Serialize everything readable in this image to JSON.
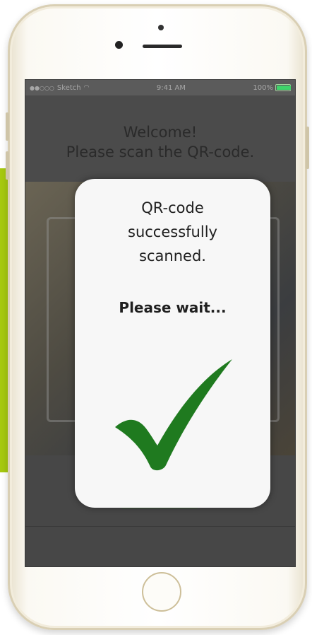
{
  "status_bar": {
    "carrier": "Sketch",
    "signal_icon": "signal-dots-icon",
    "wifi_icon": "wifi-icon",
    "time": "9:41 AM",
    "battery_percent": "100%",
    "battery_level": 1.0,
    "battery_color": "#3fd46a"
  },
  "header": {
    "line1": "Welcome!",
    "line2": "Please scan the QR-code."
  },
  "modal": {
    "message": "QR-code\nsuccessfully\nscanned.",
    "wait_text": "Please wait...",
    "icon": "checkmark-icon",
    "icon_color": "#1f7a1f"
  },
  "colors": {
    "accent_panel": "#a6c90f",
    "phone_frame": "#d9cfb4"
  }
}
